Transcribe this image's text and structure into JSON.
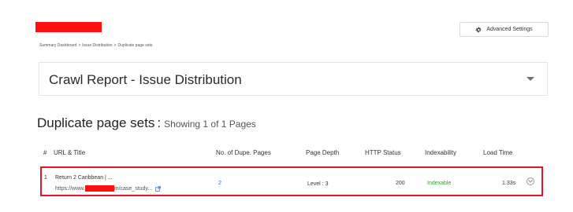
{
  "header": {
    "advanced_settings_label": "Advanced Settings"
  },
  "breadcrumb": {
    "items": [
      "Summary Dashboard",
      "Issue Distribution",
      "Duplicate page sets"
    ],
    "separator": ">"
  },
  "report": {
    "title": "Crawl Report - Issue Distribution"
  },
  "section": {
    "heading": "Duplicate page sets",
    "colon": ":",
    "count_text": "Showing 1 of 1 Pages"
  },
  "table": {
    "columns": [
      "#",
      "URL & Title",
      "No. of Dupe. Pages",
      "Page Depth",
      "HTTP Status",
      "Indexability",
      "Load Time"
    ],
    "rows": [
      {
        "num": "1",
        "title": "Return 2 Caribbean | ...",
        "url_prefix": "https://www.",
        "url_suffix": "m/case_study...",
        "dupes": "2",
        "depth": "Level : 3",
        "status": "200",
        "indexability": "Indexable",
        "load_time": "1.33s"
      }
    ]
  },
  "colors": {
    "redaction": "#ff1010",
    "row_highlight_border": "#e5132b",
    "link_blue": "#2f6fd6",
    "indexable_green": "#2aa52a"
  },
  "icons": {
    "settings": "gear-icon",
    "external_link": "external-link-icon",
    "expand": "chevron-down-circle-icon",
    "collapse": "caret-down-icon"
  }
}
